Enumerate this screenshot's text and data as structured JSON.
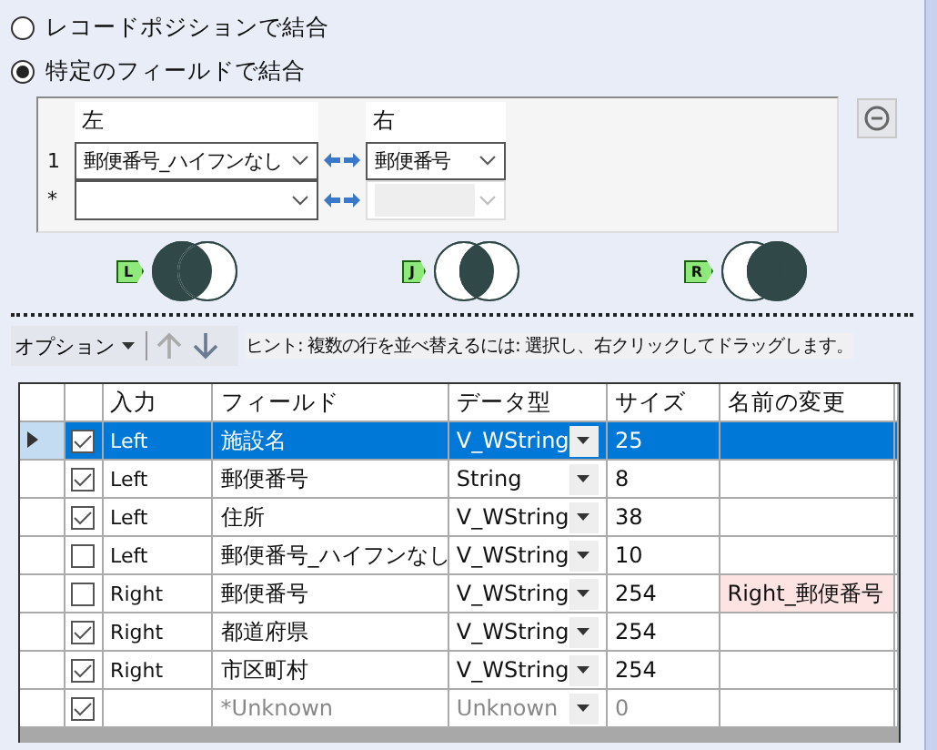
{
  "join_options": [
    {
      "label": "レコードポジションで結合",
      "selected": false
    },
    {
      "label": "特定のフィールドで結合",
      "selected": true
    }
  ],
  "join_grid": {
    "columns": [
      "左",
      "右"
    ],
    "rows": [
      {
        "number": "1",
        "left": "郵便番号_ハイフンなし",
        "right": "郵便番号",
        "right_disabled": false
      },
      {
        "number": "*",
        "right_disabled": true
      }
    ]
  },
  "join_outputs": [
    {
      "kind": "left",
      "badge": "L"
    },
    {
      "kind": "inner",
      "badge": "J"
    },
    {
      "kind": "right",
      "badge": "R"
    }
  ],
  "toolbar": {
    "options": "オプション",
    "hint": "ヒント: 複数の行を並べ替えるには: 選択し、右クリックしてドラッグします。"
  },
  "table": {
    "columns": [
      "入力",
      "フィールド",
      "データ型",
      "サイズ",
      "名前の変更"
    ],
    "rows": [
      {
        "selected": true,
        "checked": true,
        "disabled": false,
        "input": "Left",
        "field": "施設名",
        "type": "V_WString",
        "size": "25"
      },
      {
        "selected": false,
        "checked": true,
        "disabled": false,
        "input": "Left",
        "field": "郵便番号",
        "type": "String",
        "size": "8"
      },
      {
        "selected": false,
        "checked": true,
        "disabled": false,
        "input": "Left",
        "field": "住所",
        "type": "V_WString",
        "size": "38"
      },
      {
        "selected": false,
        "checked": false,
        "disabled": false,
        "input": "Left",
        "field": "郵便番号_ハイフンなし",
        "type": "V_WString",
        "size": "10"
      },
      {
        "selected": false,
        "checked": false,
        "disabled": false,
        "input": "Right",
        "field": "郵便番号",
        "type": "V_WString",
        "size": "254",
        "rename": "Right_郵便番号"
      },
      {
        "selected": false,
        "checked": true,
        "disabled": false,
        "input": "Right",
        "field": "都道府県",
        "type": "V_WString",
        "size": "254"
      },
      {
        "selected": false,
        "checked": true,
        "disabled": false,
        "input": "Right",
        "field": "市区町村",
        "type": "V_WString",
        "size": "254"
      },
      {
        "selected": false,
        "checked": true,
        "disabled": true,
        "field": "*Unknown",
        "type": "Unknown",
        "size": "0"
      }
    ]
  }
}
